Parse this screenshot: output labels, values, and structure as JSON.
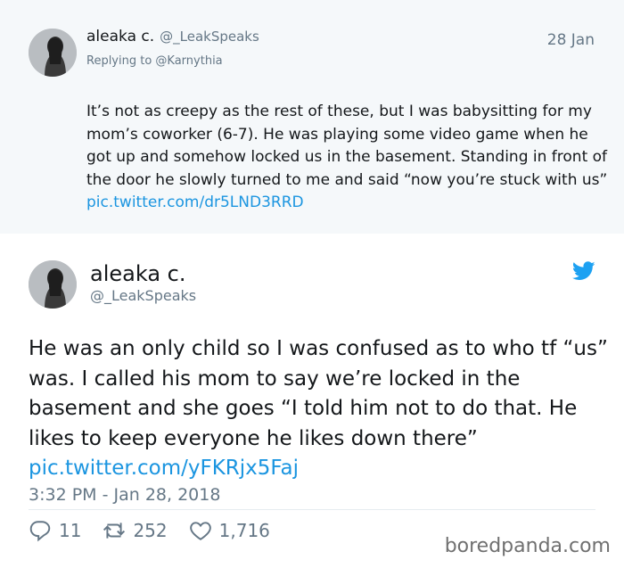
{
  "reply_tweet": {
    "name": "aleaka c.",
    "handle": "@_LeakSpeaks",
    "date": "28 Jan",
    "replying_to": "Replying to @Karnythia",
    "text": "It’s not as creepy as the rest of these, but I was babysitting for my mom’s coworker (6-7). He was playing some video game when he got up and somehow locked us in the basement. Standing in front of the door he slowly turned to me and said “now you’re stuck with us”",
    "link": "pic.twitter.com/dr5LND3RRD"
  },
  "main_tweet": {
    "name": "aleaka c.",
    "handle": "@_LeakSpeaks",
    "text": "He was an only child so I was confused as to who tf “us” was. I called his mom to say we’re locked in the basement and she goes “I told him not to do that. He likes to keep everyone he likes down there”",
    "link": "pic.twitter.com/yFKRjx5Faj",
    "timestamp": "3:32 PM - Jan 28, 2018",
    "replies": "11",
    "retweets": "252",
    "likes": "1,716"
  },
  "watermark": "boredpanda.com",
  "colors": {
    "link": "#1b95e0",
    "twitter_blue": "#1da1f2",
    "muted": "#657786",
    "reply_bg": "#f5f8fa"
  },
  "icons": [
    "twitter-bird-icon",
    "reply-icon",
    "retweet-icon",
    "like-icon"
  ]
}
